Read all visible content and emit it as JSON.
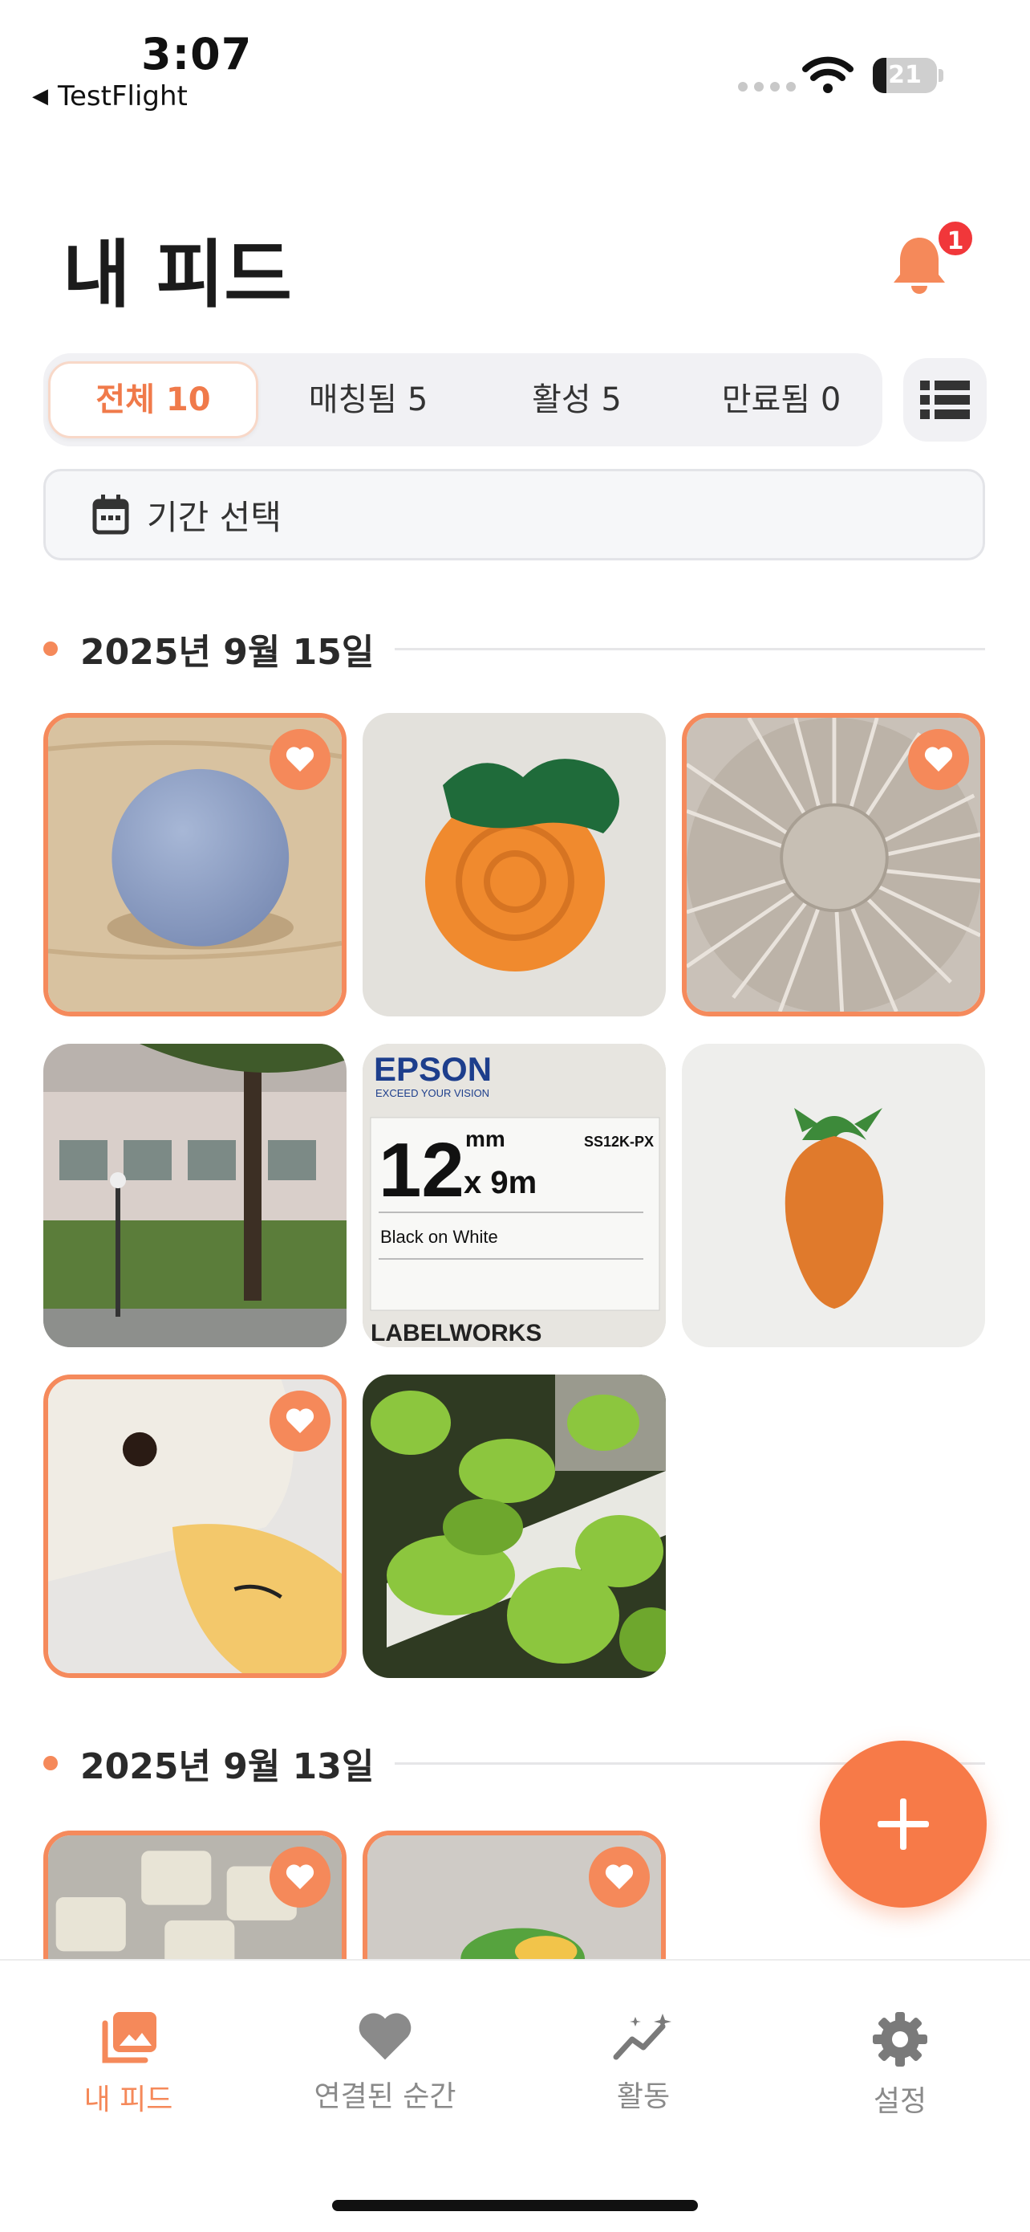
{
  "status_bar": {
    "time": "3:07",
    "back_app": "TestFlight",
    "battery": "21",
    "battery_level": 0.21
  },
  "header": {
    "title": "내 피드",
    "notification_count": "1"
  },
  "filter_tabs": [
    {
      "label": "전체 10",
      "active": true
    },
    {
      "label": "매칭됨 5",
      "active": false
    },
    {
      "label": "활성 5",
      "active": false
    },
    {
      "label": "만료됨 0",
      "active": false
    }
  ],
  "date_filter": {
    "label": "기간 선택"
  },
  "sections": [
    {
      "date": "2025년 9월 15일",
      "photos": [
        {
          "subject": "blue ball",
          "matched": true
        },
        {
          "subject": "crocheted persimmon",
          "matched": false
        },
        {
          "subject": "desk fan",
          "matched": true
        },
        {
          "subject": "trees by building",
          "matched": false
        },
        {
          "subject": "epson label tape",
          "matched": false,
          "text": {
            "brand": "EPSON",
            "tagline": "EXCEED YOUR VISION",
            "size_a": "12",
            "unit_a": "mm",
            "size_b": "x 9m",
            "model": "SS12K-PX",
            "desc": "Black on White",
            "series": "LABELWORKS"
          }
        },
        {
          "subject": "embroidered carrot",
          "matched": false
        },
        {
          "subject": "plush duck",
          "matched": true
        },
        {
          "subject": "green plants",
          "matched": false
        }
      ]
    },
    {
      "date": "2025년 9월 13일",
      "photos": [
        {
          "subject": "keypad",
          "matched": true
        },
        {
          "subject": "toy",
          "matched": true
        }
      ]
    }
  ],
  "fab": {
    "icon": "plus-icon"
  },
  "tab_bar": [
    {
      "label": "내 피드",
      "icon": "photo-library-icon",
      "active": true
    },
    {
      "label": "연결된 순간",
      "icon": "heart-icon",
      "active": false
    },
    {
      "label": "활동",
      "icon": "activity-chart-icon",
      "active": false
    },
    {
      "label": "설정",
      "icon": "gear-icon",
      "active": false
    }
  ],
  "colors": {
    "accent": "#f5895a",
    "fab": "#f77a48",
    "badge": "#f1373a",
    "inactive": "#8a8a8a"
  }
}
